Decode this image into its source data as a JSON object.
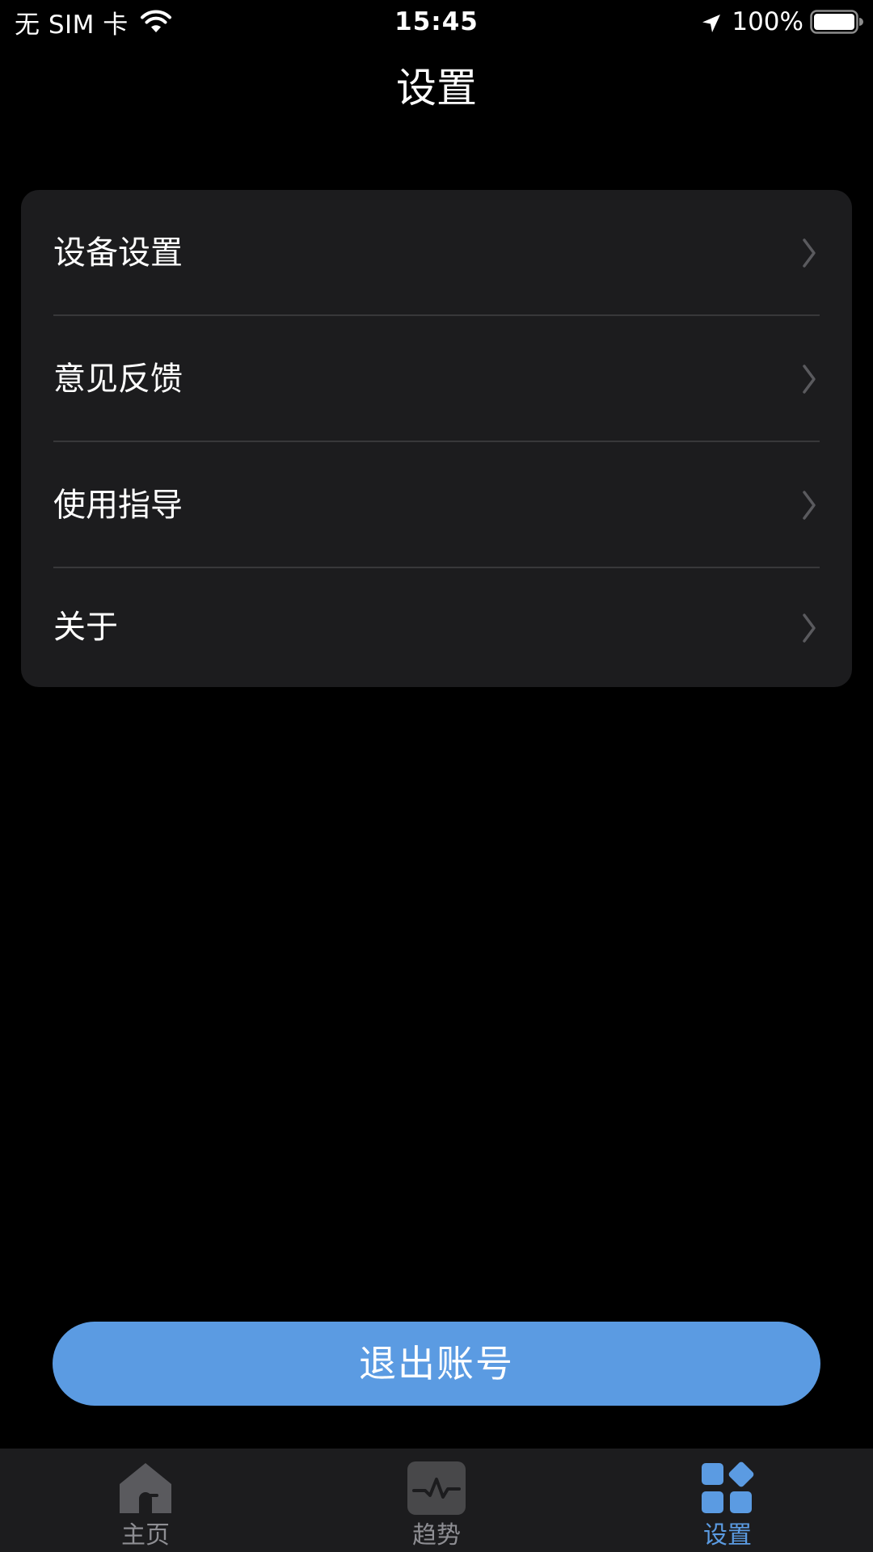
{
  "status_bar": {
    "carrier": "无 SIM 卡",
    "time": "15:45",
    "battery": "100%",
    "icons": [
      "wifi-icon",
      "location-arrow-icon",
      "battery-icon"
    ]
  },
  "header": {
    "title": "设置"
  },
  "settings": {
    "items": [
      {
        "label": "设备设置"
      },
      {
        "label": "意见反馈"
      },
      {
        "label": "使用指导"
      },
      {
        "label": "关于"
      }
    ]
  },
  "logout": {
    "label": "退出账号"
  },
  "tab_bar": {
    "items": [
      {
        "label": "主页",
        "icon": "home-icon",
        "active": false
      },
      {
        "label": "趋势",
        "icon": "pulse-chart-icon",
        "active": false
      },
      {
        "label": "设置",
        "icon": "grid-icon",
        "active": true
      }
    ]
  },
  "colors": {
    "background": "#000000",
    "card": "#1c1c1e",
    "accent": "#5b9be2",
    "inactive": "#8e8e93"
  }
}
